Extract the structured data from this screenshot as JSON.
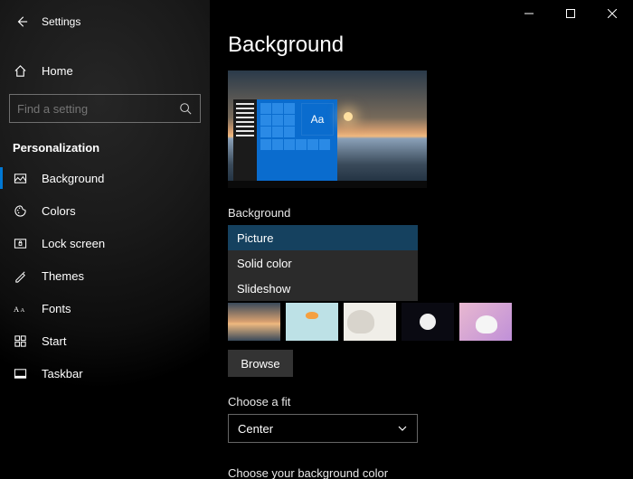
{
  "app": {
    "title": "Settings"
  },
  "home": {
    "label": "Home"
  },
  "search": {
    "placeholder": "Find a setting"
  },
  "category": {
    "label": "Personalization"
  },
  "nav": {
    "items": [
      {
        "label": "Background"
      },
      {
        "label": "Colors"
      },
      {
        "label": "Lock screen"
      },
      {
        "label": "Themes"
      },
      {
        "label": "Fonts"
      },
      {
        "label": "Start"
      },
      {
        "label": "Taskbar"
      }
    ]
  },
  "page": {
    "title": "Background",
    "preview_tile_text": "Aa",
    "background_label": "Background",
    "dropdown": {
      "options": [
        "Picture",
        "Solid color",
        "Slideshow"
      ],
      "selected": "Picture"
    },
    "browse_label": "Browse",
    "fit_label": "Choose a fit",
    "fit_value": "Center",
    "bgcolor_label": "Choose your background color"
  }
}
